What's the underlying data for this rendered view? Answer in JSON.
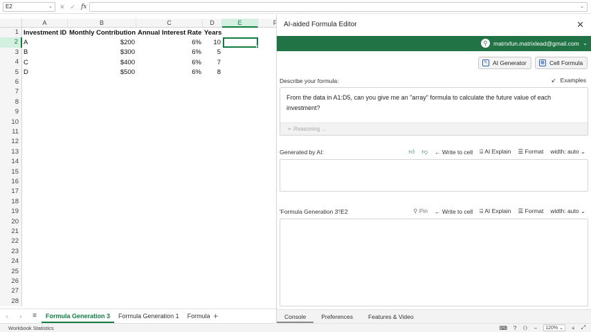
{
  "formula_bar": {
    "name_box": "E2",
    "cancel_icon": "✕",
    "confirm_icon": "✓",
    "fx_label": "fx",
    "formula": ""
  },
  "grid": {
    "columns": [
      "A",
      "B",
      "C",
      "D",
      "E",
      "F"
    ],
    "active_column": "E",
    "rows": [
      "1",
      "2",
      "3",
      "4",
      "5",
      "6",
      "7",
      "8",
      "9",
      "10",
      "11",
      "12",
      "13",
      "14",
      "15",
      "16",
      "17",
      "18",
      "19",
      "20",
      "21",
      "22",
      "23",
      "24",
      "25",
      "26",
      "27",
      "28"
    ],
    "active_row": "2",
    "headers": [
      "Investment ID",
      "Monthly Contribution",
      "Annual Interest Rate",
      "Years"
    ],
    "data": [
      [
        "A",
        "$200",
        "6%",
        "10"
      ],
      [
        "B",
        "$300",
        "6%",
        "5"
      ],
      [
        "C",
        "$400",
        "6%",
        "7"
      ],
      [
        "D",
        "$500",
        "6%",
        "8"
      ]
    ]
  },
  "sheet_tabs": {
    "tabs": [
      "Formula Generation 3",
      "Formula Generation 1",
      "Formula"
    ],
    "active": "Formula Generation 3",
    "add_label": "+"
  },
  "status_bar": {
    "left_text": "Workbook Statistics",
    "zoom": "120%"
  },
  "pane": {
    "title": "AI-aided Formula Editor",
    "account_email": "matrixfun.matrixlead@gmail.com",
    "mode_buttons": [
      "AI Generator",
      "Cell Formula"
    ],
    "describe_label": "Describe your formula:",
    "examples_label": "Examples",
    "prompt_text": "From the data in A1:D5, can you give me an \"array\" formula to calculate the future value of each investment?",
    "status_text": "Reasoning ...",
    "generated_label": "Generated by AI:",
    "cell_ref_label": "'Formula Generation 3'!E2",
    "actions": {
      "pin": "Pin",
      "write_to_cell": "Write to cell",
      "ai_explain": "AI Explain",
      "format": "Format",
      "width": "width: auto"
    },
    "bottom_tabs": [
      "Console",
      "Preferences",
      "Features & Video"
    ],
    "active_bottom_tab": "Console"
  }
}
